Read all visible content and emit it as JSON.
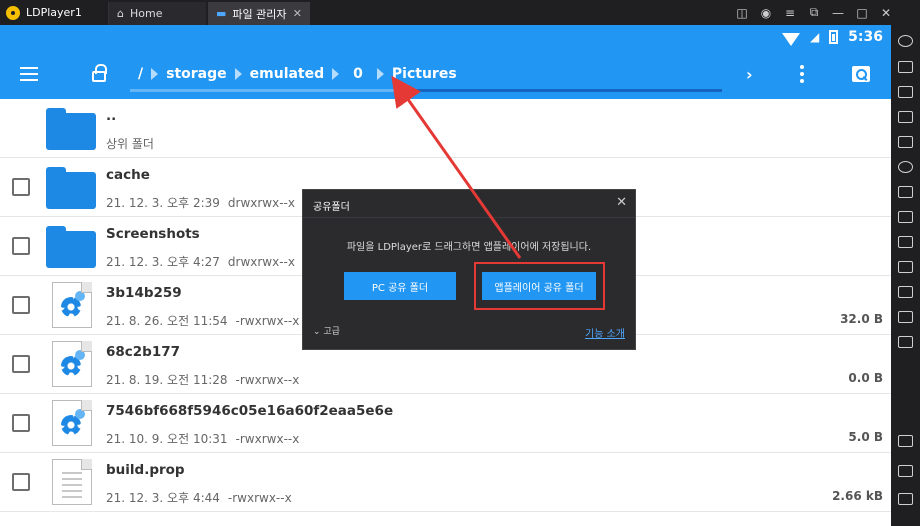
{
  "window": {
    "app_title": "LDPlayer1",
    "tabs": [
      {
        "label": "Home"
      },
      {
        "label": "파일 관리자"
      }
    ]
  },
  "status": {
    "time": "5:36"
  },
  "toolbar": {
    "breadcrumb": [
      "/",
      "storage",
      "emulated",
      "0",
      "Pictures"
    ]
  },
  "files": [
    {
      "name": "..",
      "meta": "상위 폴더",
      "perm": "",
      "size": "",
      "kind": "folder"
    },
    {
      "name": "cache",
      "meta": "21. 12. 3. 오후 2:39",
      "perm": "drwxrwx--x",
      "size": "",
      "kind": "folder"
    },
    {
      "name": "Screenshots",
      "meta": "21. 12. 3. 오후 4:27",
      "perm": "drwxrwx--x",
      "size": "",
      "kind": "folder"
    },
    {
      "name": "3b14b259",
      "meta": "21. 8. 26. 오전 11:54",
      "perm": "-rwxrwx--x",
      "size": "32.0 B",
      "kind": "gear"
    },
    {
      "name": "68c2b177",
      "meta": "21. 8. 19. 오전 11:28",
      "perm": "-rwxrwx--x",
      "size": "0.0 B",
      "kind": "gear"
    },
    {
      "name": "7546bf668f5946c05e16a60f2eaa5e6e",
      "meta": "21. 10. 9. 오전 10:31",
      "perm": "-rwxrwx--x",
      "size": "5.0 B",
      "kind": "gear"
    },
    {
      "name": "build.prop",
      "meta": "21. 12. 3. 오후 4:44",
      "perm": "-rwxrwx--x",
      "size": "2.66 kB",
      "kind": "text"
    }
  ],
  "dialog": {
    "title": "공유폴더",
    "message": "파일을 LDPlayer로 드래그하면 앱플레이어에 저장됩니다.",
    "pc_button": "PC 공유 폴더",
    "app_button": "앱플레이어 공유 폴더",
    "advanced": "고급",
    "link": "기능 소개"
  },
  "colors": {
    "accent": "#2196f3",
    "highlight": "#e53935"
  }
}
